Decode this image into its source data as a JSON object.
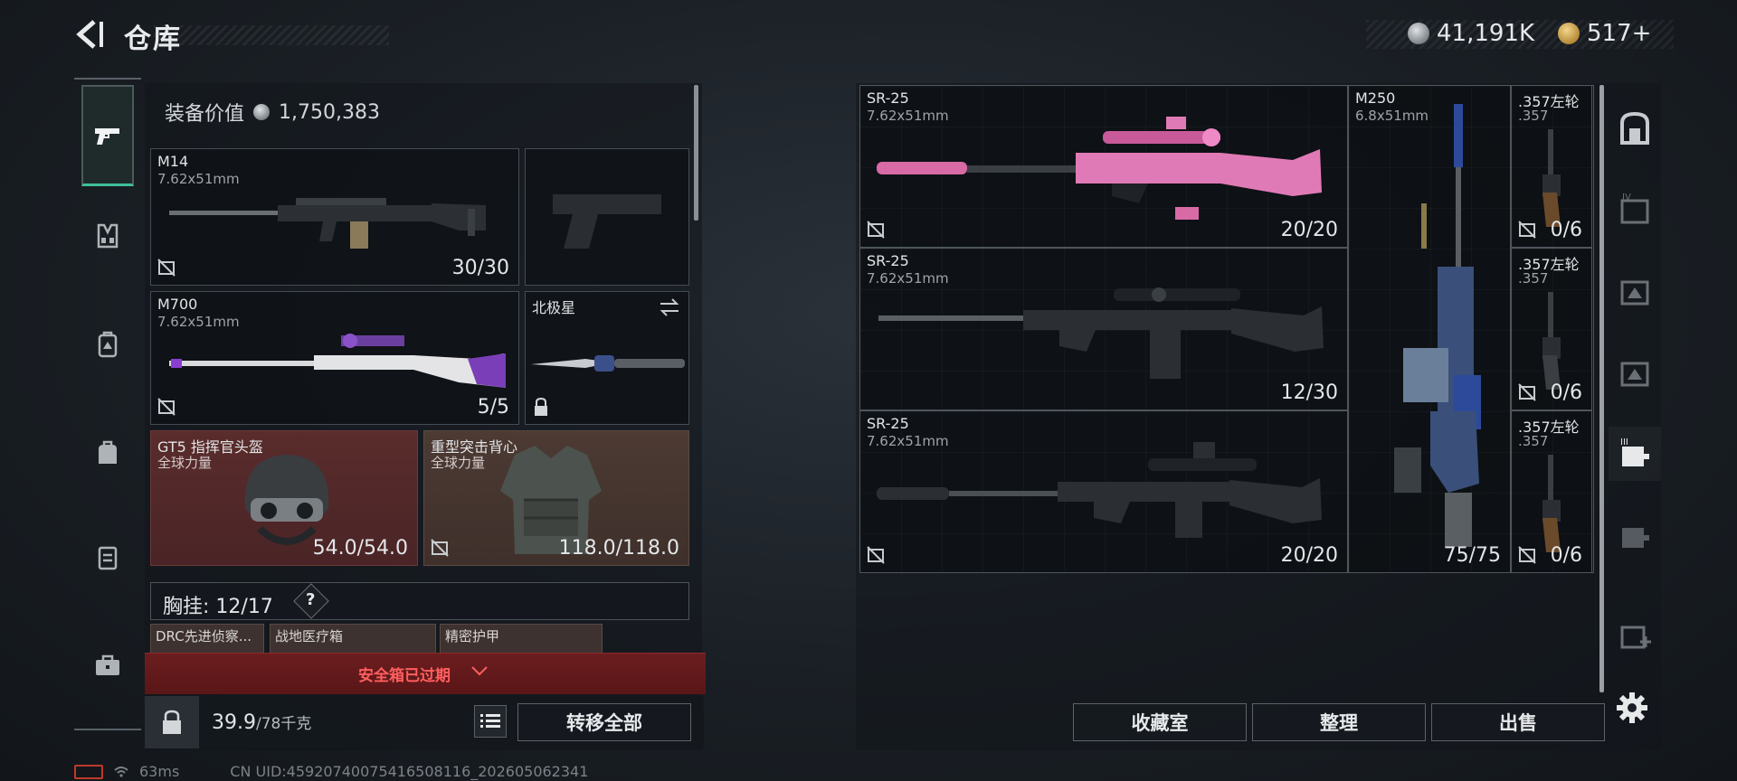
{
  "header": {
    "title": "仓库",
    "silver_amount": "41,191K",
    "gold_amount": "517+"
  },
  "left_panel": {
    "equipment_value_label": "装备价值",
    "equipment_value": "1,750,383",
    "slots": {
      "primary": {
        "name": "M14",
        "caliber": "7.62x51mm",
        "ammo": "30/30"
      },
      "secondary": {
        "name": "M700",
        "caliber": "7.62x51mm",
        "ammo": "5/5"
      },
      "melee": {
        "name": "北极星"
      },
      "helmet": {
        "name": "GT5 指挥官头盔",
        "brand": "全球力量",
        "durability": "54.0/54.0"
      },
      "armor": {
        "name": "重型突击背心",
        "brand": "全球力量",
        "durability": "118.0/118.0"
      }
    },
    "chest_rig": {
      "label": "胸挂:",
      "capacity": "12/17",
      "help": "?"
    },
    "rig_items": [
      "DRC先进侦察...",
      "战地医疗箱",
      "精密护甲"
    ],
    "safe_box_status": "安全箱已过期",
    "weight_current": "39.9",
    "weight_max": "/78千克",
    "transfer_all": "转移全部"
  },
  "stash": {
    "items": [
      {
        "name": "SR-25",
        "caliber": "7.62x51mm",
        "ammo": "20/20"
      },
      {
        "name": "SR-25",
        "caliber": "7.62x51mm",
        "ammo": "12/30"
      },
      {
        "name": "SR-25",
        "caliber": "7.62x51mm",
        "ammo": "20/20"
      },
      {
        "name": "M250",
        "caliber": "6.8x51mm",
        "ammo": "75/75"
      },
      {
        "name": ".357左轮",
        "caliber": ".357",
        "ammo": "0/6"
      },
      {
        "name": ".357左轮",
        "caliber": ".357",
        "ammo": "0/6"
      },
      {
        "name": ".357左轮",
        "caliber": ".357",
        "ammo": "0/6"
      }
    ],
    "buttons": {
      "collection": "收藏室",
      "organize": "整理",
      "sell": "出售"
    }
  },
  "status_bar": {
    "ping": "63ms",
    "uid": "CN UID:4592074007541650811​6_202605062341"
  },
  "colors": {
    "accent": "#3fbf9a",
    "warning": "#ff5e5e",
    "helmet_bg": "#5a2c2c",
    "armor_bg": "#4c3a33"
  },
  "icons": [
    "back-arrow-icon",
    "pistol-icon",
    "vest-icon",
    "backpack-icon",
    "bag-icon",
    "case-icon",
    "toolbox-icon",
    "lock-icon",
    "list-icon",
    "gear-icon",
    "swap-icon",
    "no-mod-icon"
  ]
}
